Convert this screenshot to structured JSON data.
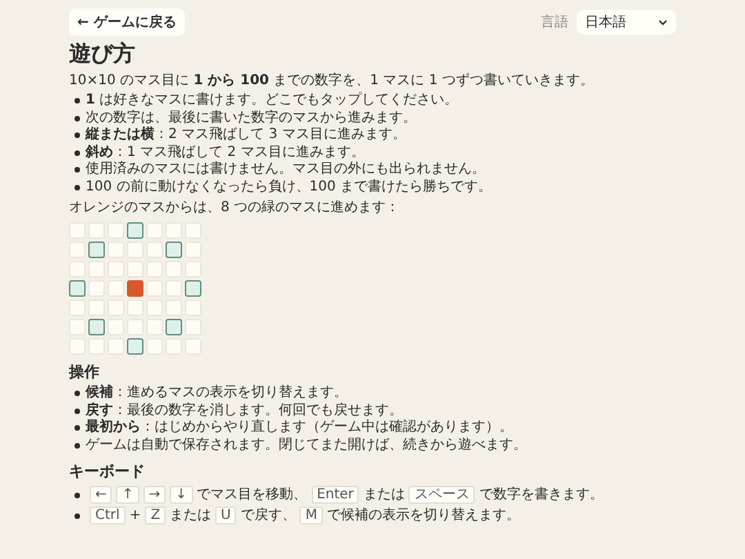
{
  "back_button": "← ゲームに戻る",
  "language": {
    "label": "言語",
    "value": "日本語"
  },
  "title": "遊び方",
  "intro": "10×10 のマス目に **1 から 100** までの数字を、1 マスに 1 つずつ書いていきます。",
  "rules": [
    "**1** は好きなマスに書けます。どこでもタップしてください。",
    "次の数字は、最後に書いた数字のマスから進みます。",
    "**縦または横**：2 マス飛ばして 3 マス目に進みます。",
    "**斜め**：1 マス飛ばして 2 マス目に進みます。",
    "使用済みのマスには書けません。マス目の外にも出られません。",
    "100 の前に動けなくなったら負け、100 まで書けたら勝ちです。"
  ],
  "diagram_caption": "オレンジのマスからは、8 つの緑のマスに進めます：",
  "diagram": [
    [
      {
        "current": false,
        "reachable": false
      },
      {
        "current": false,
        "reachable": false
      },
      {
        "current": false,
        "reachable": false
      },
      {
        "current": false,
        "reachable": true
      },
      {
        "current": false,
        "reachable": false
      },
      {
        "current": false,
        "reachable": false
      },
      {
        "current": false,
        "reachable": false
      }
    ],
    [
      {
        "current": false,
        "reachable": false
      },
      {
        "current": false,
        "reachable": true
      },
      {
        "current": false,
        "reachable": false
      },
      {
        "current": false,
        "reachable": false
      },
      {
        "current": false,
        "reachable": false
      },
      {
        "current": false,
        "reachable": true
      },
      {
        "current": false,
        "reachable": false
      }
    ],
    [
      {
        "current": false,
        "reachable": false
      },
      {
        "current": false,
        "reachable": false
      },
      {
        "current": false,
        "reachable": false
      },
      {
        "current": false,
        "reachable": false
      },
      {
        "current": false,
        "reachable": false
      },
      {
        "current": false,
        "reachable": false
      },
      {
        "current": false,
        "reachable": false
      }
    ],
    [
      {
        "current": false,
        "reachable": true
      },
      {
        "current": false,
        "reachable": false
      },
      {
        "current": false,
        "reachable": false
      },
      {
        "current": true,
        "reachable": false
      },
      {
        "current": false,
        "reachable": false
      },
      {
        "current": false,
        "reachable": false
      },
      {
        "current": false,
        "reachable": true
      }
    ],
    [
      {
        "current": false,
        "reachable": false
      },
      {
        "current": false,
        "reachable": false
      },
      {
        "current": false,
        "reachable": false
      },
      {
        "current": false,
        "reachable": false
      },
      {
        "current": false,
        "reachable": false
      },
      {
        "current": false,
        "reachable": false
      },
      {
        "current": false,
        "reachable": false
      }
    ],
    [
      {
        "current": false,
        "reachable": false
      },
      {
        "current": false,
        "reachable": true
      },
      {
        "current": false,
        "reachable": false
      },
      {
        "current": false,
        "reachable": false
      },
      {
        "current": false,
        "reachable": false
      },
      {
        "current": false,
        "reachable": true
      },
      {
        "current": false,
        "reachable": false
      }
    ],
    [
      {
        "current": false,
        "reachable": false
      },
      {
        "current": false,
        "reachable": false
      },
      {
        "current": false,
        "reachable": false
      },
      {
        "current": false,
        "reachable": true
      },
      {
        "current": false,
        "reachable": false
      },
      {
        "current": false,
        "reachable": false
      },
      {
        "current": false,
        "reachable": false
      }
    ]
  ],
  "controls_heading": "操作",
  "controls": [
    "**候補**：進めるマスの表示を切り替えます。",
    "**戻す**：最後の数字を消します。何回でも戻せます。",
    "**最初から**：はじめからやり直します（ゲーム中は確認があります）。",
    "ゲームは自動で保存されます。閉じてまた開けば、続きから遊べます。"
  ],
  "keyboard_heading": "キーボード",
  "keyboard": [
    [
      {
        "kind": "key",
        "text": "←"
      },
      {
        "kind": "key",
        "text": "↑"
      },
      {
        "kind": "key",
        "text": "→"
      },
      {
        "kind": "key",
        "text": "↓"
      },
      {
        "kind": "text",
        "text": "でマス目を移動、"
      },
      {
        "kind": "key",
        "text": "Enter"
      },
      {
        "kind": "text",
        "text": "または"
      },
      {
        "kind": "key",
        "text": "スペース"
      },
      {
        "kind": "text",
        "text": "で数字を書きます。"
      }
    ],
    [
      {
        "kind": "key",
        "text": "Ctrl"
      },
      {
        "kind": "text",
        "text": "+"
      },
      {
        "kind": "key",
        "text": "Z"
      },
      {
        "kind": "text",
        "text": "または"
      },
      {
        "kind": "key",
        "text": "U"
      },
      {
        "kind": "text",
        "text": "で戻す、"
      },
      {
        "kind": "key",
        "text": "M"
      },
      {
        "kind": "text",
        "text": "で候補の表示を切り替えます。"
      }
    ]
  ]
}
